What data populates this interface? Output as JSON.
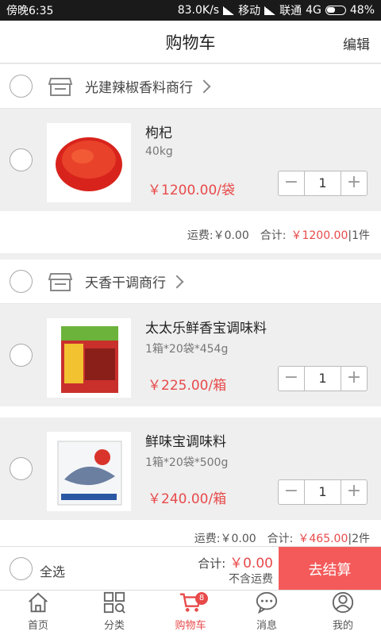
{
  "status_bar": {
    "time": "傍晚6:35",
    "speed": "83.0K/s",
    "carrier1": "移动",
    "carrier2": "联通",
    "network": "4G",
    "battery": "48%"
  },
  "header": {
    "title": "购物车",
    "edit_label": "编辑"
  },
  "shops": [
    {
      "name": "光建辣椒香料商行",
      "items": [
        {
          "name": "枸杞",
          "spec": "40kg",
          "price": "￥1200.00/袋",
          "quantity": "1"
        }
      ],
      "summary": {
        "shipping": "运费:￥0.00",
        "total_label": "合计:",
        "total": "￥1200.00",
        "count": "|1件"
      }
    },
    {
      "name": "天香干调商行",
      "items": [
        {
          "name": "太太乐鲜香宝调味料",
          "spec": "1箱*20袋*454g",
          "price": "￥225.00/箱",
          "quantity": "1"
        },
        {
          "name": "鲜味宝调味料",
          "spec": "1箱*20袋*500g",
          "price": "￥240.00/箱",
          "quantity": "1"
        }
      ],
      "summary": {
        "shipping": "运费:￥0.00",
        "total_label": "合计:",
        "total": "￥465.00",
        "count": "|2件"
      }
    }
  ],
  "checkout": {
    "select_all": "全选",
    "total_label": "合计:",
    "total": "￥0.00",
    "note": "不含运费",
    "button": "去结算"
  },
  "tabs": [
    {
      "label": "首页",
      "icon": "home-icon"
    },
    {
      "label": "分类",
      "icon": "category-icon"
    },
    {
      "label": "购物车",
      "icon": "cart-icon",
      "badge": "8"
    },
    {
      "label": "消息",
      "icon": "message-icon"
    },
    {
      "label": "我的",
      "icon": "profile-icon"
    }
  ],
  "colors": {
    "accent": "#e84a4a",
    "checkout_button": "#f45a5a",
    "background": "#efefef"
  }
}
